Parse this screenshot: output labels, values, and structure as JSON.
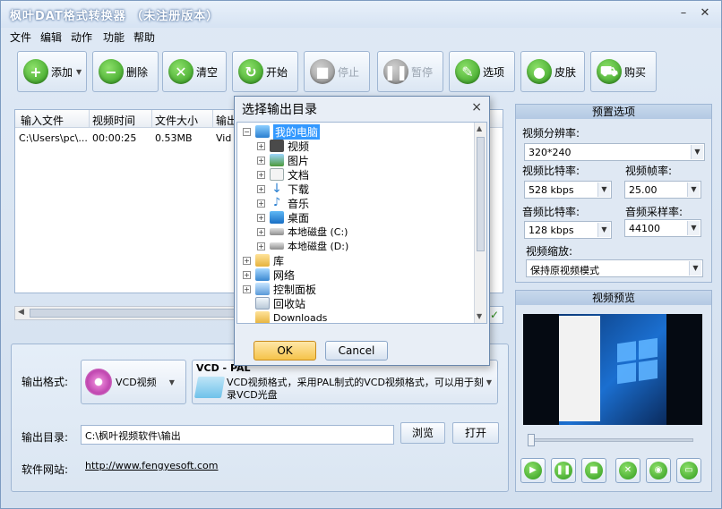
{
  "app": {
    "title": "枫叶DAT格式转换器 （未注册版本）"
  },
  "menu": [
    "文件",
    "编辑",
    "动作",
    "功能",
    "帮助"
  ],
  "toolbar": {
    "add": "添加",
    "delete": "删除",
    "clear": "清空",
    "start": "开始",
    "stop": "停止",
    "pause": "暂停",
    "options": "选项",
    "skin": "皮肤",
    "buy": "购买"
  },
  "filelist": {
    "columns": [
      "输入文件",
      "视频时间",
      "文件大小",
      "输出"
    ],
    "rows": [
      {
        "file": "C:\\Users\\pc\\...",
        "duration": "00:00:25",
        "size": "0.53MB",
        "output": "Vid"
      }
    ]
  },
  "output": {
    "format_label": "输出格式:",
    "format_value": "VCD视频",
    "desc_title": "VCD - PAL",
    "desc_text": "VCD视频格式，采用PAL制式的VCD视频格式，可以用于刻录VCD光盘",
    "dir_label": "输出目录:",
    "dir_value": "C:\\枫叶视频软件\\输出",
    "browse": "浏览",
    "open": "打开",
    "site_label": "软件网站:",
    "site_url": "http://www.fengyesoft.com"
  },
  "preset": {
    "title": "预置选项",
    "resolution_label": "视频分辨率:",
    "resolution_value": "320*240",
    "vbitrate_label": "视频比特率:",
    "vbitrate_value": "528 kbps",
    "fps_label": "视频帧率:",
    "fps_value": "25.00",
    "abitrate_label": "音频比特率:",
    "abitrate_value": "128 kbps",
    "samplerate_label": "音频采样率:",
    "samplerate_value": "44100",
    "scale_label": "视频缩放:",
    "scale_value": "保持原视频模式"
  },
  "preview": {
    "title": "视频预览",
    "seek_position": 0.0
  },
  "dialog": {
    "title": "选择输出目录",
    "close": "×",
    "nodes": [
      {
        "label": "我的电脑",
        "selected": true
      },
      {
        "label": "视频"
      },
      {
        "label": "图片"
      },
      {
        "label": "文档"
      },
      {
        "label": "下载"
      },
      {
        "label": "音乐"
      },
      {
        "label": "桌面"
      },
      {
        "label": "本地磁盘 (C:)"
      },
      {
        "label": "本地磁盘 (D:)"
      },
      {
        "label": "库"
      },
      {
        "label": "网络"
      },
      {
        "label": "控制面板"
      },
      {
        "label": "回收站"
      },
      {
        "label": "Downloads"
      }
    ],
    "ok": "OK",
    "cancel": "Cancel"
  },
  "colors": {
    "accent": "#3399ff",
    "ok_button": "#f5c34a",
    "green_icon": "#2f9a1c"
  }
}
